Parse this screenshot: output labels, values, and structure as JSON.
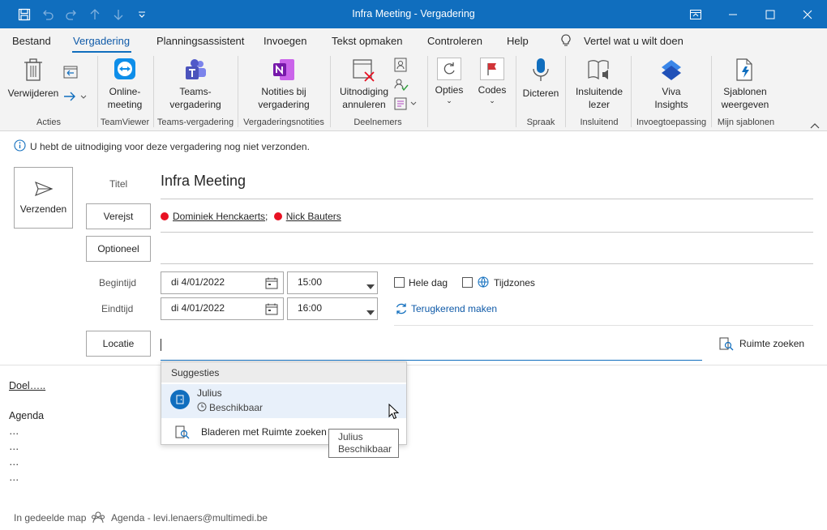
{
  "window": {
    "title": "Infra Meeting  -  Vergadering"
  },
  "menu": {
    "tabs": [
      "Bestand",
      "Vergadering",
      "Planningsassistent",
      "Invoegen",
      "Tekst opmaken",
      "Controleren",
      "Help"
    ],
    "tell_me": "Vertel wat u wilt doen"
  },
  "ribbon": {
    "buttons": {
      "delete": "Verwijderen",
      "online_meeting_1": "Online-",
      "online_meeting_2": "meeting",
      "teams_1": "Teams-",
      "teams_2": "vergadering",
      "notes_1": "Notities bij",
      "notes_2": "vergadering",
      "cancel_1": "Uitnodiging",
      "cancel_2": "annuleren",
      "options": "Opties",
      "codes": "Codes",
      "dictate": "Dicteren",
      "reader_1": "Insluitende",
      "reader_2": "lezer",
      "viva_1": "Viva",
      "viva_2": "Insights",
      "templates_1": "Sjablonen",
      "templates_2": "weergeven"
    },
    "groups": [
      "Acties",
      "TeamViewer",
      "Teams-vergadering",
      "Vergaderingsnotities",
      "Deelnemers",
      "Spraak",
      "Insluitend",
      "Invoegtoepassing",
      "Mijn sjablonen"
    ]
  },
  "infobar": {
    "message": "U hebt de uitnodiging voor deze vergadering nog niet verzonden."
  },
  "form": {
    "send_label": "Verzenden",
    "title_label": "Titel",
    "title_value": "Infra Meeting",
    "required_label": "Verejst",
    "required_people": [
      "Dominiek Henckaerts",
      "Nick Bauters"
    ],
    "optional_label": "Optioneel",
    "start_label": "Begintijd",
    "end_label": "Eindtijd",
    "start_date": "di 4/01/2022",
    "start_time": "15:00",
    "end_date": "di 4/01/2022",
    "end_time": "16:00",
    "all_day": "Hele dag",
    "timezones": "Tijdzones",
    "recurring": "Terugkerend maken",
    "location_label": "Locatie",
    "room_finder": "Ruimte zoeken"
  },
  "suggestions": {
    "header": "Suggesties",
    "item_name": "Julius",
    "item_status": "Beschikbaar",
    "browse": "Bladeren met Ruimte zoeken"
  },
  "tooltip": {
    "line1": "Julius",
    "line2": "Beschikbaar"
  },
  "body": {
    "lines": [
      "Doel…..",
      "",
      "Agenda",
      "…",
      "…",
      "…",
      "…"
    ]
  },
  "status": {
    "shared": "In gedeelde map",
    "calendar": "Agenda - levi.lenaers@multimedi.be"
  },
  "colors": {
    "accent": "#106ebe",
    "required_dot": "#e81123"
  }
}
